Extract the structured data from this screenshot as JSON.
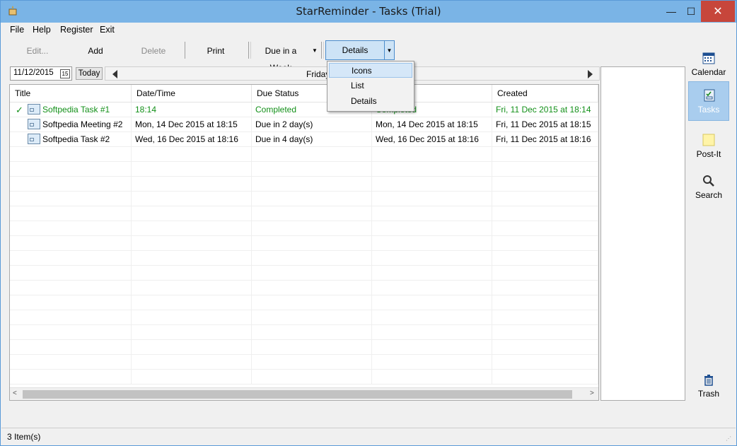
{
  "window": {
    "title": "StarReminder - Tasks  (Trial)",
    "minimize": "—",
    "maximize": "☐",
    "close": "✕"
  },
  "menu": [
    "File",
    "Help",
    "Register",
    "Exit"
  ],
  "toolbar": {
    "edit": "Edit...",
    "add": "Add",
    "delete": "Delete",
    "print": "Print",
    "filter": "Due in a Week",
    "view": "Details"
  },
  "datebar": {
    "date": "11/12/2015",
    "cal_day": "15",
    "today": "Today",
    "day": "Friday"
  },
  "columns": [
    "Title",
    "Date/Time",
    "Due Status",
    "",
    "Created"
  ],
  "rows": [
    {
      "check": "✓",
      "title": "Softpedia Task #1",
      "datetime": "18:14",
      "status": "Completed",
      "due": "Completed",
      "created": "Fri, 11 Dec 2015 at 18:14"
    },
    {
      "check": "",
      "title": "Softpedia Meeting #2",
      "datetime": "Mon, 14 Dec 2015 at 18:15",
      "status": "Due in 2 day(s)",
      "due": "Mon, 14 Dec 2015 at 18:15",
      "created": "Fri, 11 Dec 2015 at 18:15"
    },
    {
      "check": "",
      "title": "Softpedia Task #2",
      "datetime": "Wed, 16 Dec 2015 at 18:16",
      "status": "Due in 4 day(s)",
      "due": "Wed, 16 Dec 2015 at 18:16",
      "created": "Fri, 11 Dec 2015 at 18:16"
    }
  ],
  "view_menu": [
    "Icons",
    "List",
    "Details"
  ],
  "sidebar": [
    "Calendar",
    "Tasks",
    "Post-It",
    "Search",
    "Trash"
  ],
  "status": "3 Item(s)",
  "colors": {
    "completed": "#139019",
    "title_bar": "#7ab4e6",
    "selected": "#a9cdee"
  }
}
